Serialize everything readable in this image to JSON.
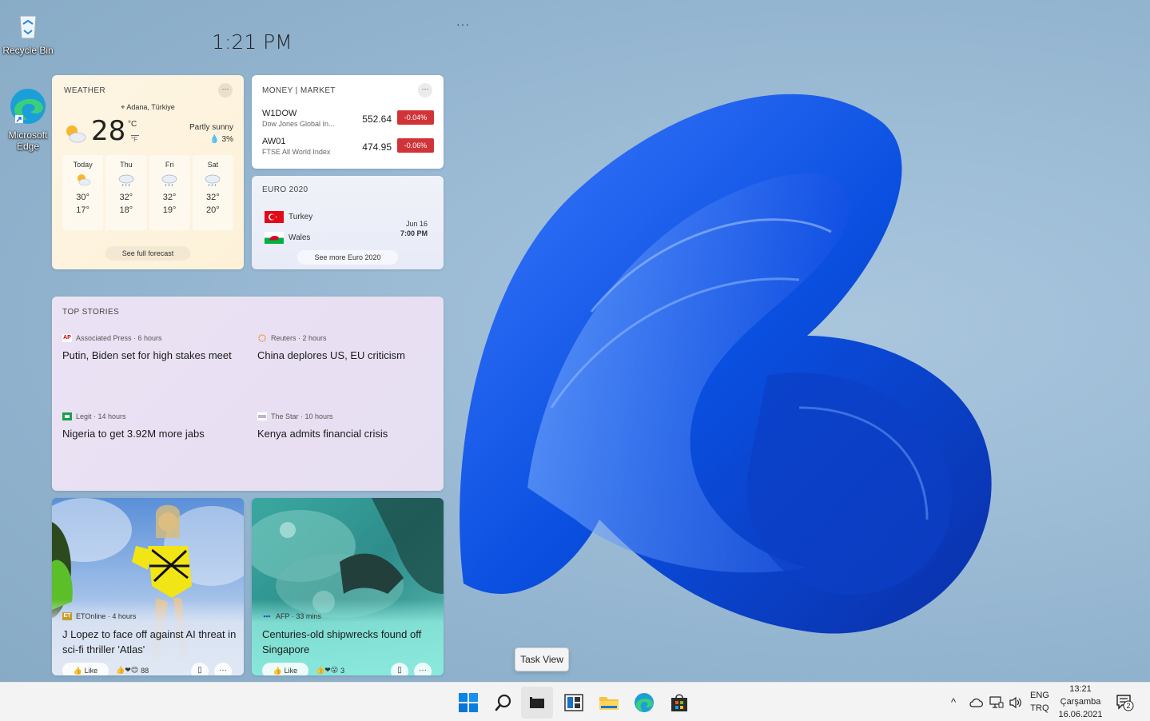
{
  "desktop": {
    "recycle_bin_label": "Recycle Bin",
    "edge_label": "Microsoft Edge"
  },
  "widgets": {
    "clock": "1:21 PM",
    "top_menu": "···"
  },
  "weather": {
    "title": "WEATHER",
    "location": "Adana, Türkiye",
    "temp": "28",
    "unit_c": "°C",
    "unit_f": "°F",
    "condition": "Partly sunny",
    "precip": "💧 3%",
    "days": [
      {
        "name": "Today",
        "hi": "30°",
        "lo": "17°",
        "icon": "partly-sunny-icon"
      },
      {
        "name": "Thu",
        "hi": "32°",
        "lo": "18°",
        "icon": "rain-cloud-icon"
      },
      {
        "name": "Fri",
        "hi": "32°",
        "lo": "19°",
        "icon": "rain-cloud-icon"
      },
      {
        "name": "Sat",
        "hi": "32°",
        "lo": "20°",
        "icon": "rain-cloud-icon"
      }
    ],
    "forecast_link": "See full forecast",
    "menu": "···"
  },
  "money": {
    "title": "MONEY | MARKET",
    "menu": "···",
    "stocks": [
      {
        "symbol": "W1DOW",
        "name": "Dow Jones Global In...",
        "value": "552.64",
        "change": "-0.04%"
      },
      {
        "symbol": "AW01",
        "name": "FTSE All World Index",
        "value": "474.95",
        "change": "-0.06%"
      }
    ],
    "negative_color": "#d13438"
  },
  "euro": {
    "title": "EURO 2020",
    "team1": "Turkey",
    "team2": "Wales",
    "date": "Jun 16",
    "time": "7:00 PM",
    "more": "See more Euro 2020"
  },
  "stories": {
    "title": "TOP STORIES",
    "items": [
      {
        "source": "Associated Press · 6 hours",
        "logo": "AP",
        "headline": "Putin, Biden set for high stakes meet"
      },
      {
        "source": "Reuters · 2 hours",
        "logo": "",
        "headline": "China deplores US, EU criticism"
      },
      {
        "source": "Legit · 14 hours",
        "logo": "",
        "headline": "Nigeria to get 3.92M more jabs"
      },
      {
        "source": "The Star · 10 hours",
        "logo": "",
        "headline": "Kenya admits financial crisis"
      }
    ]
  },
  "cards": [
    {
      "source": "ETOnline · 4 hours",
      "logo": "ET",
      "headline": "J Lopez to face off against AI threat in sci-fi thriller 'Atlas'",
      "like": "Like",
      "reactions": "88",
      "more": "···"
    },
    {
      "source": "AFP · 33 mins",
      "logo": "",
      "headline": "Centuries-old shipwrecks found off Singapore",
      "like": "Like",
      "reactions": "3",
      "more": "···"
    }
  ],
  "tooltip": "Task View",
  "taskbar": {
    "lang_top": "ENG",
    "lang_bottom": "TRQ",
    "time": "13:21",
    "day": "Çarşamba",
    "date": "16.06.2021",
    "notifications": "2",
    "accent": "#0078d4"
  }
}
